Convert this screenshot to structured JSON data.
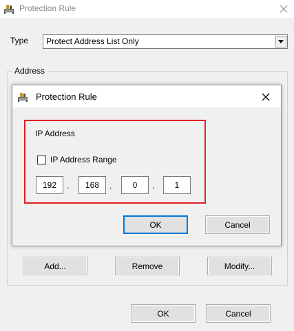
{
  "window": {
    "title": "Protection Rule",
    "icon": "network-cable-icon",
    "close_glyph": "✕"
  },
  "type_row": {
    "label": "Type",
    "selected": "Protect Address List Only"
  },
  "address_group": {
    "legend": "Address",
    "buttons": {
      "add": "Add...",
      "remove": "Remove",
      "modify": "Modify..."
    }
  },
  "inner_dialog": {
    "title": "Protection Rule",
    "close_glyph": "✕",
    "heading": "IP Address",
    "range_checkbox": {
      "label": "IP Address Range",
      "checked": false
    },
    "ip_octets": [
      "192",
      "168",
      "0",
      "1"
    ],
    "dot": ".",
    "ok": "OK",
    "cancel": "Cancel"
  },
  "footer": {
    "ok": "OK",
    "cancel": "Cancel"
  },
  "colors": {
    "highlight": "#e01f1f",
    "focus": "#0078d7"
  }
}
